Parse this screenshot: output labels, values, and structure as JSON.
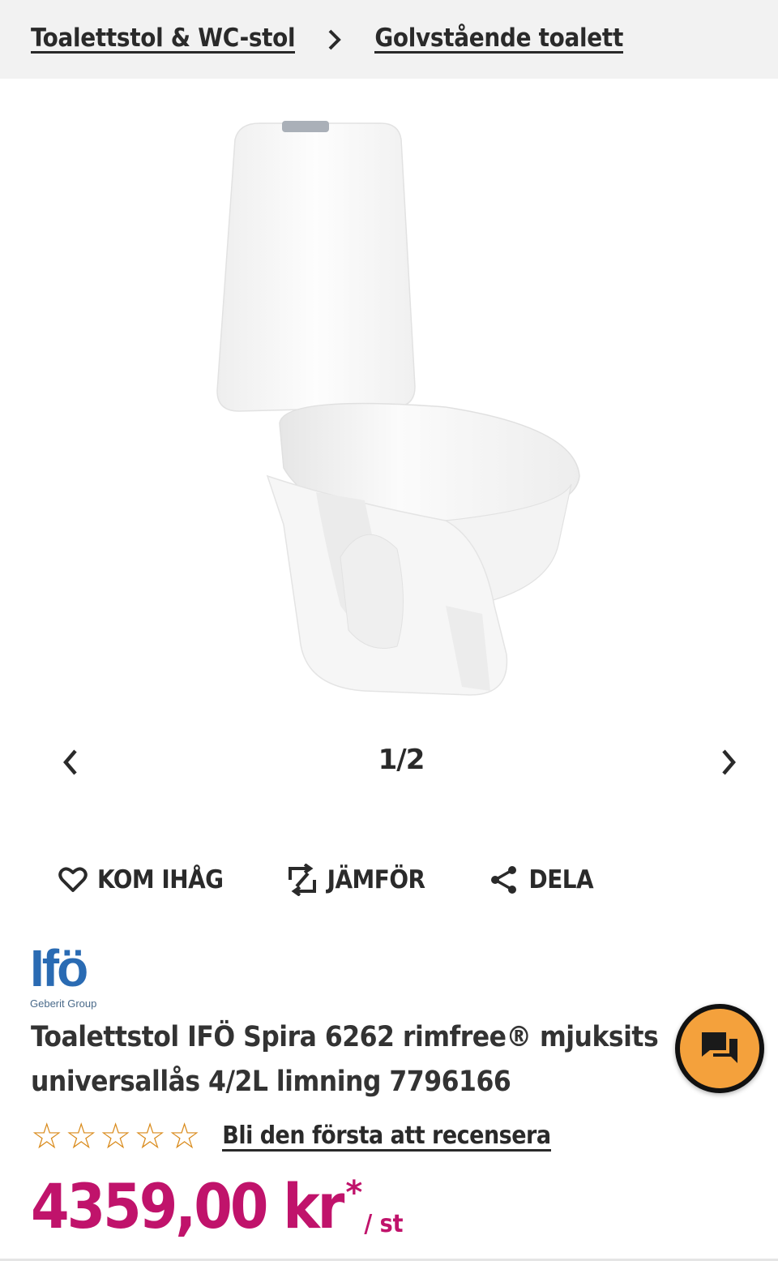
{
  "breadcrumb": {
    "items": [
      {
        "label": "Toalettstol & WC-stol"
      },
      {
        "label": "Golvstående toalett"
      }
    ]
  },
  "gallery": {
    "counter": "1/2",
    "image_alt": "Toalettstol IFÖ Spira 6262"
  },
  "actions": {
    "remember_label": "KOM IHÅG",
    "compare_label": "JÄMFÖR",
    "share_label": "DELA"
  },
  "brand": {
    "name": "Ifö",
    "sub": "Geberit Group"
  },
  "product": {
    "title": "Toalettstol IFÖ Spira 6262 rimfree® mjuksits universallås 4/2L limning 7796166",
    "rating_stars": 0,
    "rating_max": 5,
    "review_link": "Bli den första att recensera",
    "price": "4359,00 kr",
    "price_marker": "*",
    "unit": "/ st"
  },
  "colors": {
    "price": "#c0136b",
    "star": "#d98a1a",
    "chat": "#f4a13c",
    "brand": "#2a6bb3"
  }
}
